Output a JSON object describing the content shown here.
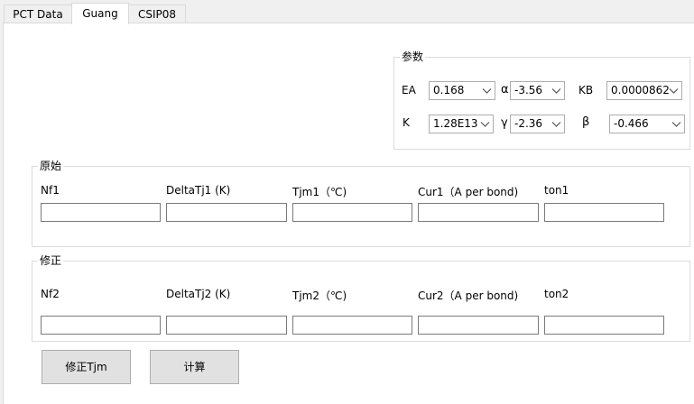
{
  "tabs": [
    {
      "label": "PCT Data"
    },
    {
      "label": "Guang"
    },
    {
      "label": "CSIP08"
    }
  ],
  "params": {
    "title": "参数",
    "ea_label": "EA",
    "ea_value": "0.168",
    "alpha_label": "α",
    "alpha_value": "-3.56",
    "kb_label": "KB",
    "kb_value": "0.0000862",
    "k_label": "K",
    "k_value": "1.28E13",
    "gamma_label": "γ",
    "gamma_value": "-2.36",
    "beta_label": "β",
    "beta_value": "-0.466"
  },
  "original": {
    "title": "原始",
    "columns": [
      "Nf1",
      "DeltaTj1  (K)",
      "Tjm1（℃)",
      "Cur1（A per bond)",
      "ton1"
    ],
    "values": [
      "",
      "",
      "",
      "",
      ""
    ]
  },
  "corrected": {
    "title": "修正",
    "columns": [
      "Nf2",
      "DeltaTj2  (K)",
      "Tjm2（℃)",
      "Cur2（A per bond)",
      "ton2"
    ],
    "values": [
      "",
      "",
      "",
      "",
      ""
    ]
  },
  "buttons": {
    "correct_tjm": "修正Tjm",
    "calculate": "计算"
  }
}
